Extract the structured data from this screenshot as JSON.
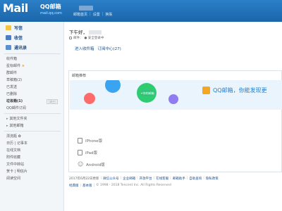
{
  "header": {
    "logo_text": "Mail",
    "brand": "QQ邮箱",
    "domain": "mail.qq.com",
    "top_links": [
      "邮箱首页",
      "设置",
      "换肤"
    ]
  },
  "sidebar": {
    "primary": [
      {
        "label": "写信",
        "icon": "pencil-icon"
      },
      {
        "label": "收信",
        "icon": "envelope-icon"
      },
      {
        "label": "通讯录",
        "icon": "contacts-icon"
      }
    ],
    "folders": [
      {
        "label": "收件箱"
      },
      {
        "label": "星标邮件",
        "star": "★"
      },
      {
        "label": "群邮件"
      },
      {
        "label": "草稿箱(2)"
      },
      {
        "label": "已发送"
      },
      {
        "label": "已删除"
      },
      {
        "label": "垃圾箱(1)",
        "badge": "[清空]"
      },
      {
        "label": "QQ邮件订阅"
      }
    ],
    "groups": [
      {
        "label": "其他文件夹"
      },
      {
        "label": "其他邮箱"
      }
    ],
    "apps": [
      {
        "label": "漂流瓶 ✿"
      },
      {
        "label": "日历 | 记事本"
      },
      {
        "label": "在线文档"
      },
      {
        "label": "附件收藏"
      },
      {
        "label": "文件中转站"
      },
      {
        "label": "贺卡 | 明信片"
      },
      {
        "label": "阅读空间"
      }
    ]
  },
  "main": {
    "greeting": "下午好，",
    "security": [
      "邮件：",
      "● 安全登录中"
    ],
    "quick_links": [
      "进入收件箱",
      "订阅中心(27)"
    ],
    "recommend_title": "邮箱推荐",
    "banner_text": "QQ邮箱，你能发现更",
    "banner_tag": "+你的邮箱",
    "clients": [
      {
        "label": "iPhone版",
        "icon": "apple-icon"
      },
      {
        "label": "iPad版",
        "icon": "tablet-icon"
      },
      {
        "label": "Android版",
        "icon": "android-icon"
      }
    ],
    "footer_links": [
      "2017年6月22日更新",
      "|",
      "微信公众号",
      "|",
      "企业邮箱",
      "|",
      "开放平台",
      "|",
      "在线客服",
      "|",
      "邮箱助手",
      "|",
      "自助查询",
      "|",
      "隐私政策"
    ],
    "footer_copyright": [
      "经典版",
      "|",
      "基本版",
      "|",
      "© 1998 - 2018 Tencent Inc. All Rights Reserved"
    ]
  }
}
